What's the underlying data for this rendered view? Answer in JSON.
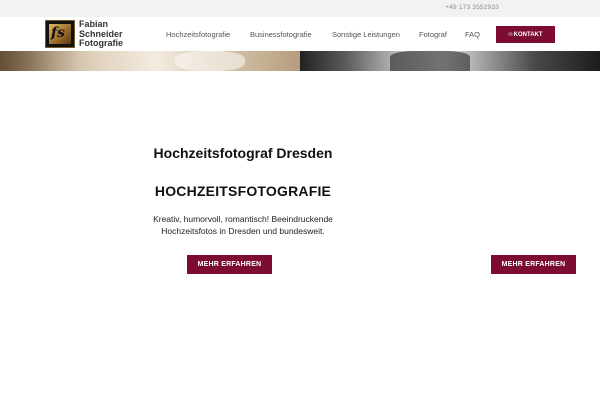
{
  "topbar": {
    "phone": "+49 173 3552933"
  },
  "logo": {
    "mark": "fs",
    "line1": "Fabian",
    "line2": "Schneider",
    "line3": "Fotografie"
  },
  "nav": {
    "items": [
      "Hochzeitsfotografie",
      "Businessfotografie",
      "Sonstige Leistungen",
      "Fotograf",
      "FAQ"
    ],
    "contact_icon": "✉",
    "contact_label": "KONTAKT"
  },
  "hero": {
    "title": "Hochzeitsfotograf Dresden",
    "subtitle": "HOCHZEITSFOTOGRAFIE",
    "description": "Kreativ, humorvoll, romantisch! Beeindruckende Hochzeitsfotos in Dresden und bundesweit.",
    "button_label": "MEHR ERFAHREN"
  },
  "secondary": {
    "button_label": "MEHR ERFAHREN"
  },
  "colors": {
    "accent": "#7d0c34",
    "topbar": "#f2f2f2"
  }
}
